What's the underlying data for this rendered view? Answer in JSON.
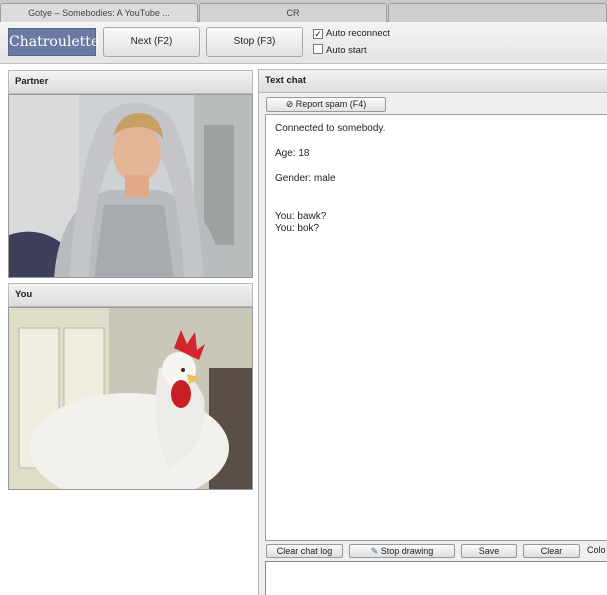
{
  "browser": {
    "tabs": [
      {
        "label": "Gotye – Somebodies: A YouTube ..."
      },
      {
        "label": "CR"
      },
      {
        "label": ""
      }
    ]
  },
  "toolbar": {
    "logo": "Chatroulette",
    "next_label": "Next (F2)",
    "stop_label": "Stop (F3)",
    "auto_reconnect": {
      "label": "Auto reconnect",
      "checked": true
    },
    "auto_start": {
      "label": "Auto start",
      "checked": false
    }
  },
  "partner": {
    "title": "Partner"
  },
  "you": {
    "title": "You"
  },
  "text_chat": {
    "title": "Text chat",
    "report_spam_label": "Report spam (F4)",
    "lines": {
      "connected": "Connected to somebody.",
      "age": "Age: 18",
      "gender": "Gender: male",
      "msg1": "You: bawk?",
      "msg2": "You: bok?"
    },
    "buttons": {
      "clear_log": "Clear chat log",
      "stop_drawing": "Stop drawing",
      "save": "Save",
      "clear": "Clear"
    },
    "color_label": "Colo",
    "input_value": ""
  },
  "colors": {
    "logo_bg": "#6a7aa3",
    "panel_border": "#b9b9b9"
  }
}
